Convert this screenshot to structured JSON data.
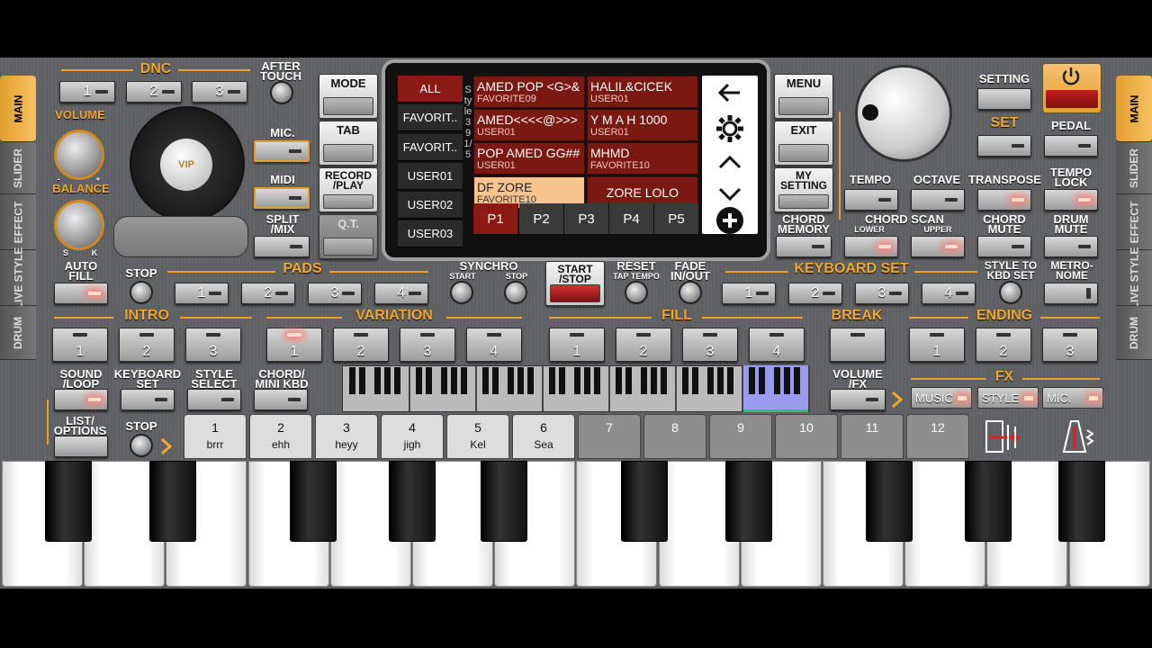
{
  "side_left": [
    "MAIN",
    "SLIDER",
    "EFFECT",
    "LIVE STYLE",
    "DRUM"
  ],
  "side_right": [
    "MAIN",
    "SLIDER",
    "EFFECT",
    "LIVE STYLE",
    "DRUM"
  ],
  "dnc": {
    "title": "DNC",
    "buttons": [
      "1",
      "2",
      "3"
    ],
    "after_touch": "AFTER\nTOUCH"
  },
  "volume": "VOLUME",
  "balance": "BALANCE",
  "balance_marks": {
    "left": "S",
    "right": "K",
    "minus": "-",
    "plus": "+"
  },
  "logo_text": "VIP",
  "left_col": {
    "mic": "MIC.",
    "midi": "MIDI",
    "split": "SPLIT\n/MIX"
  },
  "mid_col": {
    "mode": "MODE",
    "tab": "TAB",
    "record": "RECORD\n/PLAY",
    "qt": "Q.T."
  },
  "screen": {
    "categories": [
      "ALL",
      "FAVORIT..",
      "FAVORIT..",
      "USER01",
      "USER02",
      "USER03"
    ],
    "style_label": "Style 39 1/5",
    "styles": [
      {
        "name": "AMED POP <G>&",
        "sub": "FAVORITE09"
      },
      {
        "name": "HALIL&CICEK",
        "sub": "USER01"
      },
      {
        "name": "AMED<<<<@>>>",
        "sub": "USER01"
      },
      {
        "name": "Y M A H 1000",
        "sub": "USER01"
      },
      {
        "name": "POP AMED GG##",
        "sub": "USER01"
      },
      {
        "name": "MHMD",
        "sub": "FAVORITE10"
      },
      {
        "name": "DF ZORE",
        "sub": "FAVORITE10"
      },
      {
        "name": "ZORE LOLO",
        "sub": ""
      }
    ],
    "pages": [
      "P1",
      "P2",
      "P3",
      "P4",
      "P5"
    ]
  },
  "right_col": {
    "menu": "MENU",
    "exit": "EXIT",
    "my_setting": "MY\nSETTING",
    "chord_memory": "CHORD\nMEMORY"
  },
  "top_right": {
    "setting": "SETTING",
    "set": "SET",
    "pedal": "PEDAL"
  },
  "row3": {
    "tempo": "TEMPO",
    "octave": "OCTAVE",
    "transpose": "TRANSPOSE",
    "tempo_lock": "TEMPO\nLOCK",
    "chord_scan": "CHORD SCAN",
    "lower": "LOWER",
    "upper": "UPPER",
    "chord_mute": "CHORD\nMUTE",
    "drum_mute": "DRUM\nMUTE"
  },
  "row4": {
    "auto_fill": "AUTO\nFILL",
    "stop": "STOP",
    "pads": "PADS",
    "pad_buttons": [
      "1",
      "2",
      "3",
      "4"
    ],
    "synchro": "SYNCHRO",
    "synchro_start": "START",
    "synchro_stop": "STOP",
    "start_stop": "START\n/STOP",
    "reset": "RESET",
    "tap_tempo": "TAP TEMPO",
    "fade": "FADE\nIN/OUT",
    "keyboard_set": "KEYBOARD SET",
    "kb_buttons": [
      "1",
      "2",
      "3",
      "4"
    ],
    "style_to_kbd": "STYLE TO\nKBD SET",
    "metronome": "METRO-\nNOME"
  },
  "row5": {
    "intro": "INTRO",
    "intro_btns": [
      "1",
      "2",
      "3"
    ],
    "variation": "VARIATION",
    "var_btns": [
      "1",
      "2",
      "3",
      "4"
    ],
    "fill": "FILL",
    "fill_btns": [
      "1",
      "2",
      "3",
      "4"
    ],
    "break": "BREAK",
    "ending": "ENDING",
    "end_btns": [
      "1",
      "2",
      "3"
    ]
  },
  "row6": {
    "sound_loop": "SOUND\n/LOOP",
    "keyboard_set": "KEYBOARD\nSET",
    "style_select": "STYLE\nSELECT",
    "chord_mini": "CHORD/\nMINI KBD",
    "volume_fx": "VOLUME\n/FX",
    "fx": "FX",
    "fx_btns": [
      "MUSIC",
      "STYLE",
      "MIC."
    ]
  },
  "row7": {
    "list_options": "LIST/\nOPTIONS",
    "stop": "STOP"
  },
  "pads_bottom": [
    {
      "num": "1",
      "label": "brrr"
    },
    {
      "num": "2",
      "label": "ehh"
    },
    {
      "num": "3",
      "label": "heyy"
    },
    {
      "num": "4",
      "label": "jigh"
    },
    {
      "num": "5",
      "label": "Kel"
    },
    {
      "num": "6",
      "label": "Sea"
    },
    {
      "num": "7",
      "label": ""
    },
    {
      "num": "8",
      "label": ""
    },
    {
      "num": "9",
      "label": ""
    },
    {
      "num": "10",
      "label": ""
    },
    {
      "num": "11",
      "label": ""
    },
    {
      "num": "12",
      "label": ""
    }
  ],
  "colors": {
    "accent": "#f0a830",
    "screen_cell": "#7a1812",
    "selected_cell": "#f7c48e"
  }
}
